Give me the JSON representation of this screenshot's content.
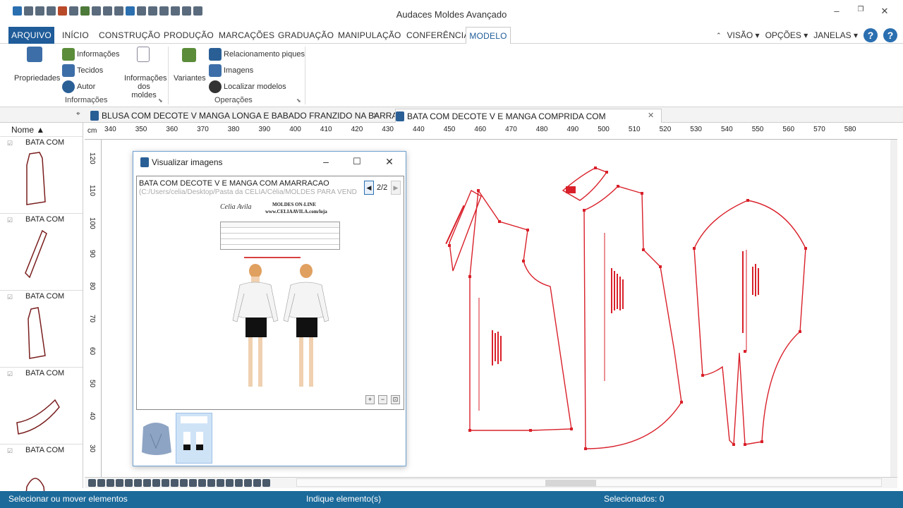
{
  "app": {
    "title": "Audaces Moldes Avançado"
  },
  "menu": [
    "ARQUIVO",
    "INÍCIO",
    "CONSTRUÇÃO",
    "PRODUÇÃO",
    "MARCAÇÕES",
    "GRADUAÇÃO",
    "MANIPULAÇÃO",
    "CONFERÊNCIA",
    "MODELO"
  ],
  "menu_right": {
    "visao": "VISÃO ▾",
    "opcoes": "OPÇÕES ▾",
    "janelas": "JANELAS ▾",
    "help": "?"
  },
  "ribbon": {
    "propriedades": "Propriedades",
    "informacoes_btn": "Informações",
    "tecidos": "Tecidos",
    "autor": "Autor",
    "info_moldes_1": "Informações",
    "info_moldes_2": "dos moldes",
    "group_informacoes": "Informações",
    "variantes": "Variantes",
    "relacionamento": "Relacionamento piques",
    "imagens": "Imagens",
    "localizar": "Localizar modelos",
    "group_operacoes": "Operações"
  },
  "tabs": [
    {
      "label": "BLUSA COM DECOTE V MANGA LONGA E BABADO FRANZIDO NA BARRA.ads"
    },
    {
      "label": "BATA COM DECOTE V E MANGA COMPRIDA COM AMARRAÇÃO.ads"
    }
  ],
  "sidebar": {
    "header": "Nome",
    "items": [
      {
        "label": "BATA COM"
      },
      {
        "label": "BATA COM"
      },
      {
        "label": "BATA COM"
      },
      {
        "label": "BATA COM"
      },
      {
        "label": "BATA COM"
      }
    ]
  },
  "ruler": {
    "unit": "cm",
    "h": [
      "340",
      "350",
      "360",
      "370",
      "380",
      "390",
      "400",
      "410",
      "420",
      "430",
      "440",
      "450",
      "460",
      "470",
      "480",
      "490",
      "500",
      "510",
      "520",
      "530",
      "540",
      "550",
      "560",
      "570",
      "580"
    ],
    "v": [
      "120",
      "110",
      "100",
      "90",
      "80",
      "70",
      "60",
      "50",
      "40",
      "30"
    ]
  },
  "dialog": {
    "title": "Visualizar imagens",
    "image_title": "BATA COM DECOTE V E MANGA COM AMARRACAO",
    "image_path": "(C:/Users/celia/Desktop/Pasta da CÉLIA/Célia/MOLDES PARA VEND",
    "counter": "2/2",
    "doc_header": "MOLDES ON-LINE",
    "doc_site": "www.CELIAAVILA.com/loja",
    "doc_signature": "Celia Avila"
  },
  "status": {
    "left": "Selecionar ou mover elementos",
    "center": "Indique elemento(s)",
    "right": "Selecionados: 0"
  },
  "colors": {
    "accent": "#1f5c99",
    "status": "#1c6a9a",
    "pattern": "#d9202a"
  }
}
